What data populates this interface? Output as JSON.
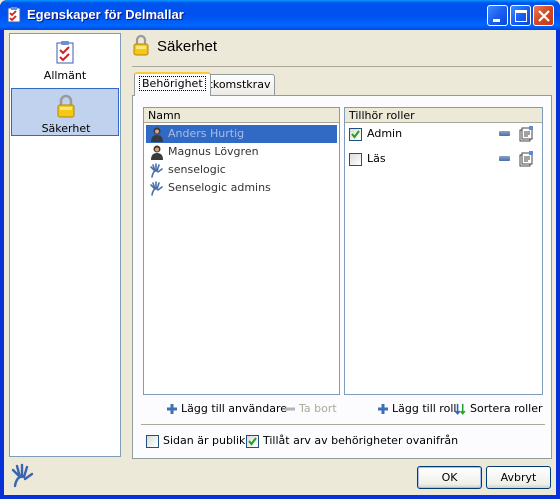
{
  "window": {
    "title": "Egenskaper för Delmallar"
  },
  "nav": {
    "items": [
      {
        "label": "Allmänt",
        "icon": "checklist-icon",
        "selected": false
      },
      {
        "label": "Säkerhet",
        "icon": "padlock-icon",
        "selected": true
      }
    ]
  },
  "header": {
    "title": "Säkerhet",
    "icon": "padlock-icon"
  },
  "tabs": [
    {
      "label": "Behörighet",
      "active": true
    },
    {
      "label": "Åtkomstkrav",
      "active": false
    }
  ],
  "users": {
    "header": "Namn",
    "items": [
      {
        "name": "Anders Hurtig",
        "type": "user",
        "selected": true
      },
      {
        "name": "Magnus Lövgren",
        "type": "user",
        "selected": false
      },
      {
        "name": "senselogic",
        "type": "group",
        "selected": false
      },
      {
        "name": "Senselogic admins",
        "type": "group",
        "selected": false
      }
    ]
  },
  "roles": {
    "header": "Tillhör roller",
    "items": [
      {
        "name": "Admin",
        "checked": true
      },
      {
        "name": "Läs",
        "checked": false
      }
    ]
  },
  "actions": {
    "add_user": "Lägg till användare",
    "remove": "Ta bort",
    "add_role": "Lägg till roll",
    "sort_roles": "Sortera roller"
  },
  "options": {
    "public_page": {
      "label": "Sidan är publik",
      "checked": false
    },
    "inherit": {
      "label": "Tillåt arv av behörigheter ovanifrån",
      "checked": true
    }
  },
  "buttons": {
    "ok": "OK",
    "cancel": "Avbryt"
  },
  "colors": {
    "titlebar": "#0054e3",
    "selection": "#316ac5",
    "nav_selected": "#c1d2ee"
  }
}
